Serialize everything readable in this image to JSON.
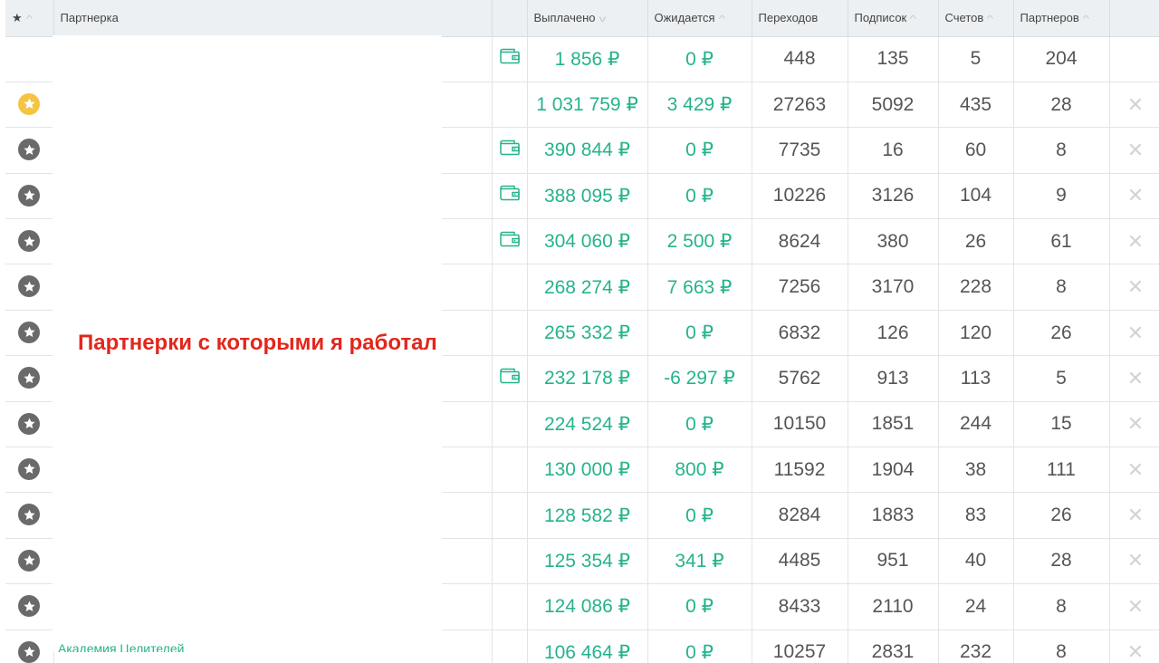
{
  "header": {
    "star_icon": "star-icon",
    "col_partner": "Партнерка",
    "col_paid": "Выплачено",
    "col_expected": "Ожидается",
    "col_transitions": "Переходов",
    "col_subscriptions": "Подписок",
    "col_accounts": "Счетов",
    "col_partners": "Партнеров"
  },
  "overlay": {
    "label": "Партнерки с которыми я работал",
    "peek_link": "Академия Целителей"
  },
  "colors": {
    "money": "#26b38c",
    "overlay_label": "#e3261c",
    "favorite_star": "#f5c443",
    "regular_star": "#6a6a6a"
  },
  "rows": [
    {
      "star": "none",
      "wallet": true,
      "paid": "1 856 ₽",
      "expected": "0 ₽",
      "transitions": "448",
      "subscriptions": "135",
      "accounts": "5",
      "partners": "204",
      "delete": false
    },
    {
      "star": "favorite",
      "wallet": false,
      "paid": "1 031 759 ₽",
      "expected": "3 429 ₽",
      "transitions": "27263",
      "subscriptions": "5092",
      "accounts": "435",
      "partners": "28",
      "delete": true
    },
    {
      "star": "regular",
      "wallet": true,
      "paid": "390 844 ₽",
      "expected": "0 ₽",
      "transitions": "7735",
      "subscriptions": "16",
      "accounts": "60",
      "partners": "8",
      "delete": true
    },
    {
      "star": "regular",
      "wallet": true,
      "paid": "388 095 ₽",
      "expected": "0 ₽",
      "transitions": "10226",
      "subscriptions": "3126",
      "accounts": "104",
      "partners": "9",
      "delete": true
    },
    {
      "star": "regular",
      "wallet": true,
      "paid": "304 060 ₽",
      "expected": "2 500 ₽",
      "transitions": "8624",
      "subscriptions": "380",
      "accounts": "26",
      "partners": "61",
      "delete": true
    },
    {
      "star": "regular",
      "wallet": false,
      "paid": "268 274 ₽",
      "expected": "7 663 ₽",
      "transitions": "7256",
      "subscriptions": "3170",
      "accounts": "228",
      "partners": "8",
      "delete": true
    },
    {
      "star": "regular",
      "wallet": false,
      "paid": "265 332 ₽",
      "expected": "0 ₽",
      "transitions": "6832",
      "subscriptions": "126",
      "accounts": "120",
      "partners": "26",
      "delete": true
    },
    {
      "star": "regular",
      "wallet": true,
      "paid": "232 178 ₽",
      "expected": "-6 297 ₽",
      "transitions": "5762",
      "subscriptions": "913",
      "accounts": "113",
      "partners": "5",
      "delete": true
    },
    {
      "star": "regular",
      "wallet": false,
      "paid": "224 524 ₽",
      "expected": "0 ₽",
      "transitions": "10150",
      "subscriptions": "1851",
      "accounts": "244",
      "partners": "15",
      "delete": true
    },
    {
      "star": "regular",
      "wallet": false,
      "paid": "130 000 ₽",
      "expected": "800 ₽",
      "transitions": "11592",
      "subscriptions": "1904",
      "accounts": "38",
      "partners": "111",
      "delete": true
    },
    {
      "star": "regular",
      "wallet": false,
      "paid": "128 582 ₽",
      "expected": "0 ₽",
      "transitions": "8284",
      "subscriptions": "1883",
      "accounts": "83",
      "partners": "26",
      "delete": true
    },
    {
      "star": "regular",
      "wallet": false,
      "paid": "125 354 ₽",
      "expected": "341 ₽",
      "transitions": "4485",
      "subscriptions": "951",
      "accounts": "40",
      "partners": "28",
      "delete": true
    },
    {
      "star": "regular",
      "wallet": false,
      "paid": "124 086 ₽",
      "expected": "0 ₽",
      "transitions": "8433",
      "subscriptions": "2110",
      "accounts": "24",
      "partners": "8",
      "delete": true
    },
    {
      "star": "regular",
      "wallet": false,
      "paid": "106 464 ₽",
      "expected": "0 ₽",
      "transitions": "10257",
      "subscriptions": "2831",
      "accounts": "232",
      "partners": "8",
      "delete": true
    }
  ]
}
